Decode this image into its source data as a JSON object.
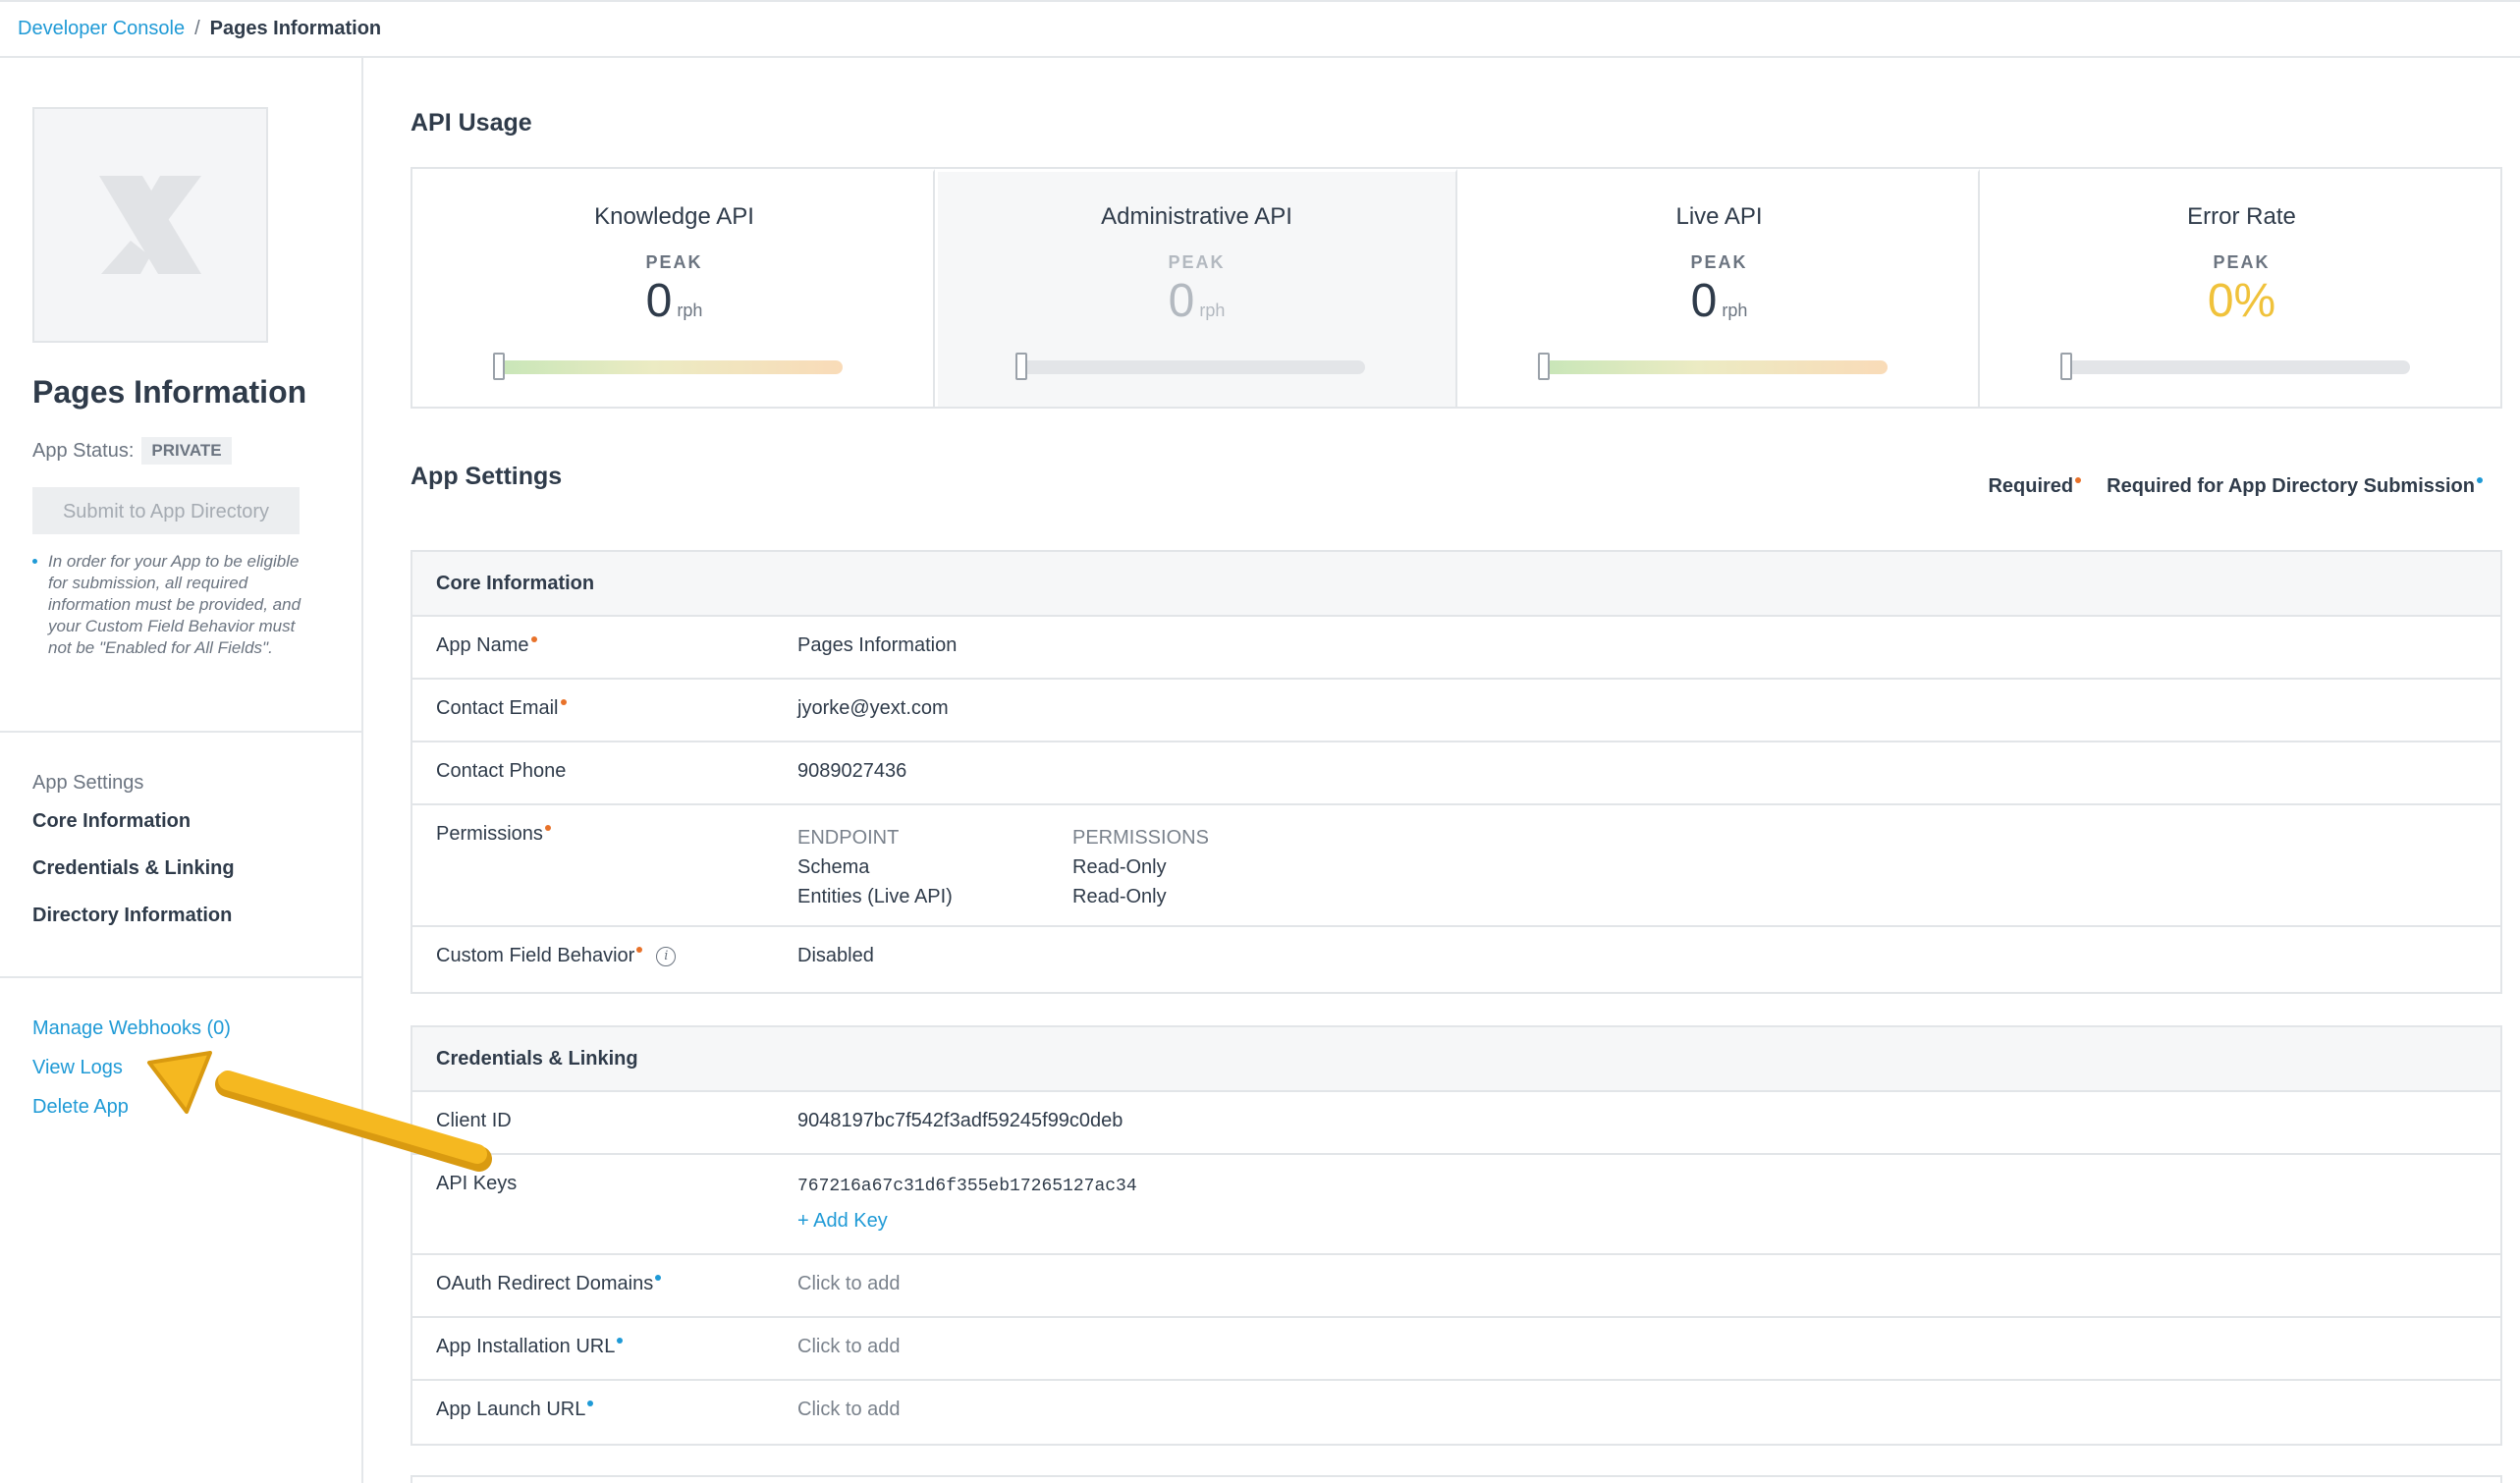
{
  "breadcrumb": {
    "root": "Developer Console",
    "separator": "/",
    "current": "Pages Information"
  },
  "sidebar": {
    "app_title": "Pages Information",
    "status_label": "App Status:",
    "status_badge": "PRIVATE",
    "submit_button": "Submit to App Directory",
    "note": "In order for your App to be eligible for submission, all required information must be provided, and your Custom Field Behavior must not be \"Enabled for All Fields\".",
    "nav_heading": "App Settings",
    "nav_items": [
      "Core Information",
      "Credentials & Linking",
      "Directory Information"
    ],
    "links": [
      "Manage Webhooks (0)",
      "View Logs",
      "Delete App"
    ]
  },
  "api_usage": {
    "title": "API Usage",
    "cards": [
      {
        "title": "Knowledge API",
        "peak": "PEAK",
        "value": "0",
        "unit": "rph",
        "level": 0
      },
      {
        "title": "Administrative API",
        "peak": "PEAK",
        "value": "0",
        "unit": "rph",
        "level": 0
      },
      {
        "title": "Live API",
        "peak": "PEAK",
        "value": "0",
        "unit": "rph",
        "level": 0
      },
      {
        "title": "Error Rate",
        "peak": "PEAK",
        "value": "0%",
        "unit": "",
        "level": 0
      }
    ]
  },
  "app_settings": {
    "title": "App Settings",
    "legend_required": "Required",
    "legend_directory": "Required for App Directory Submission",
    "core": {
      "heading": "Core Information",
      "app_name_label": "App Name",
      "app_name_value": "Pages Information",
      "email_label": "Contact Email",
      "email_value": "jyorke@yext.com",
      "phone_label": "Contact Phone",
      "phone_value": "9089027436",
      "permissions_label": "Permissions",
      "endpoint_header": "ENDPOINT",
      "permissions_header": "PERMISSIONS",
      "endpoints": [
        "Schema",
        "Entities (Live API)"
      ],
      "permission_values": [
        "Read-Only",
        "Read-Only"
      ],
      "cfb_label": "Custom Field Behavior",
      "cfb_value": "Disabled"
    },
    "credentials": {
      "heading": "Credentials & Linking",
      "client_id_label": "Client ID",
      "client_id_value": "9048197bc7f542f3adf59245f99c0deb",
      "api_keys_label": "API Keys",
      "api_key_value": "767216a67c31d6f355eb17265127ac34",
      "add_key": "+ Add Key",
      "oauth_label": "OAuth Redirect Domains",
      "oauth_value": "Click to add",
      "install_label": "App Installation URL",
      "install_value": "Click to add",
      "launch_label": "App Launch URL",
      "launch_value": "Click to add"
    }
  },
  "colors": {
    "accent": "#1f9ad6",
    "required": "#e8722a",
    "annotation_arrow": "#f5b820",
    "error_value": "#f0c23b"
  }
}
